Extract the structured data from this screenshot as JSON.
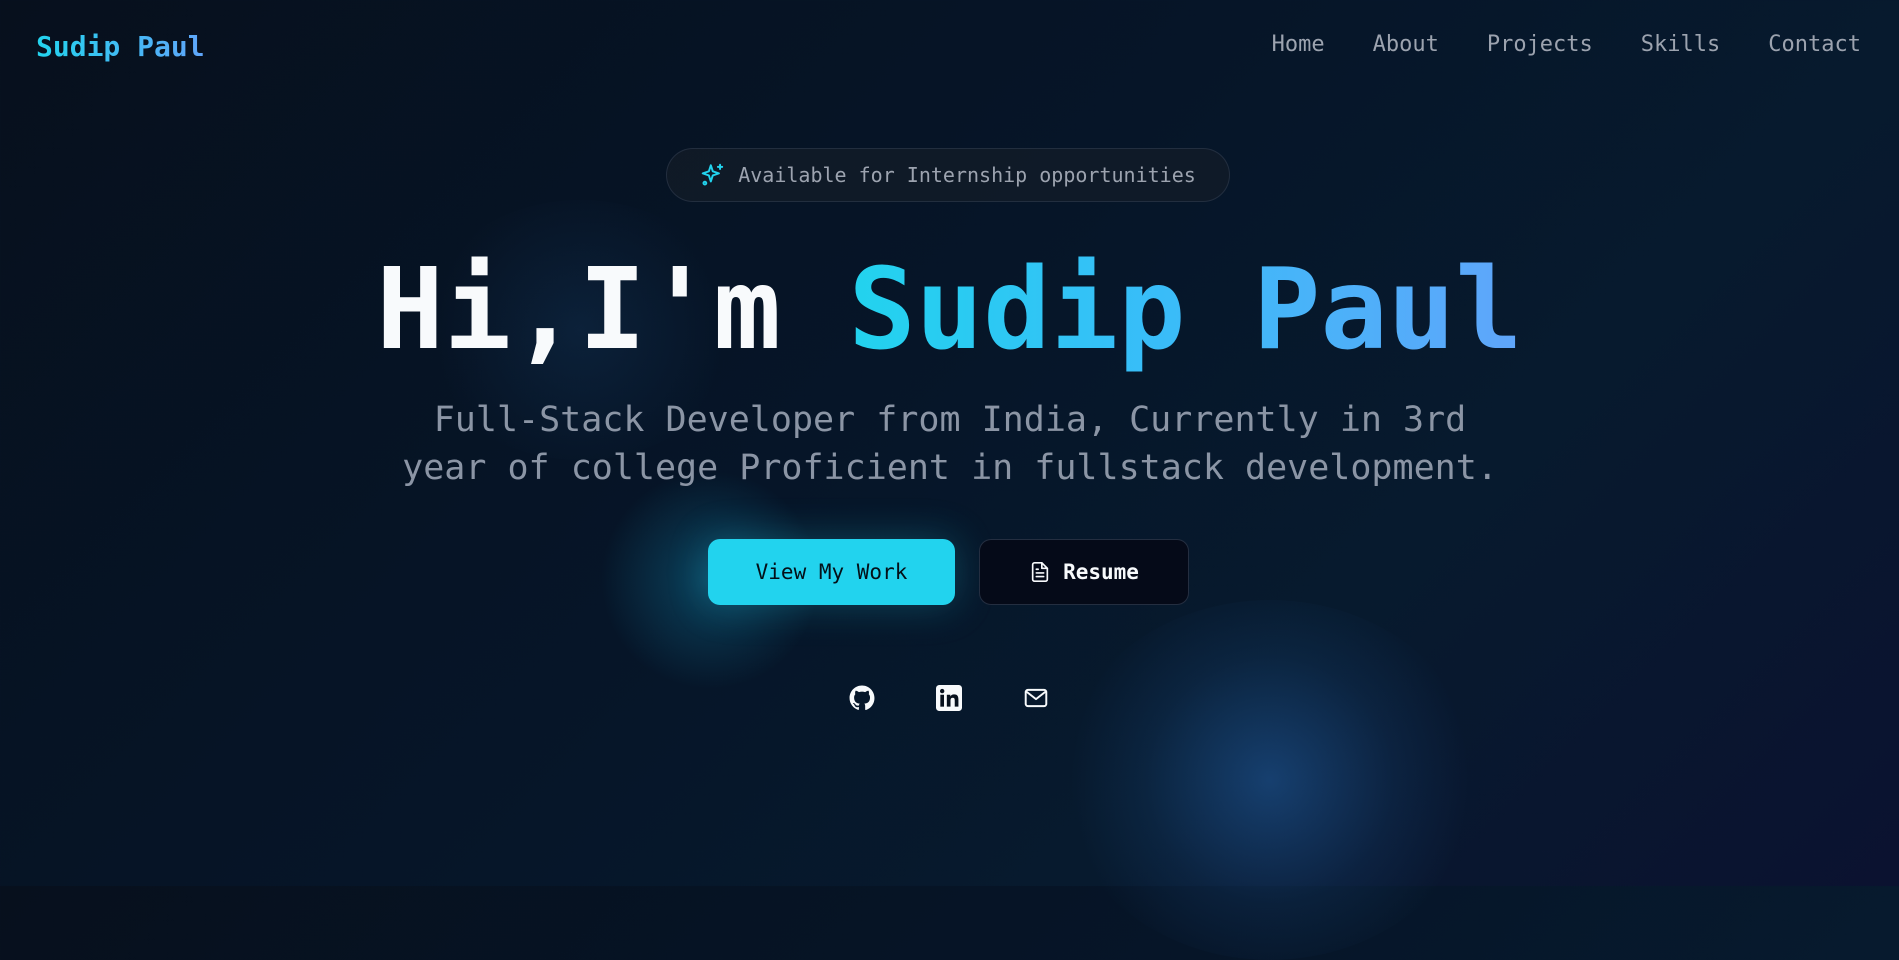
{
  "nav": {
    "logo": "Sudip Paul",
    "links": [
      "Home",
      "About",
      "Projects",
      "Skills",
      "Contact"
    ]
  },
  "badge": {
    "icon": "sparkles-icon",
    "text": "Available for Internship opportunities"
  },
  "hero": {
    "greeting": "Hi,I'm",
    "name": "Sudip Paul",
    "subtitle_line1": "Full-Stack Developer from India, Currently in 3rd",
    "subtitle_line2": "year of college Proficient in fullstack development."
  },
  "buttons": {
    "primary": "View My Work",
    "secondary": "Resume",
    "secondary_icon": "document-icon"
  },
  "social": {
    "icons": [
      "github-icon",
      "linkedin-icon",
      "mail-icon"
    ]
  },
  "colors": {
    "accent": "#22d3ee",
    "accent_gradient_end": "#60a5fa",
    "background": "#07101d",
    "muted_text": "#9ca3af"
  }
}
